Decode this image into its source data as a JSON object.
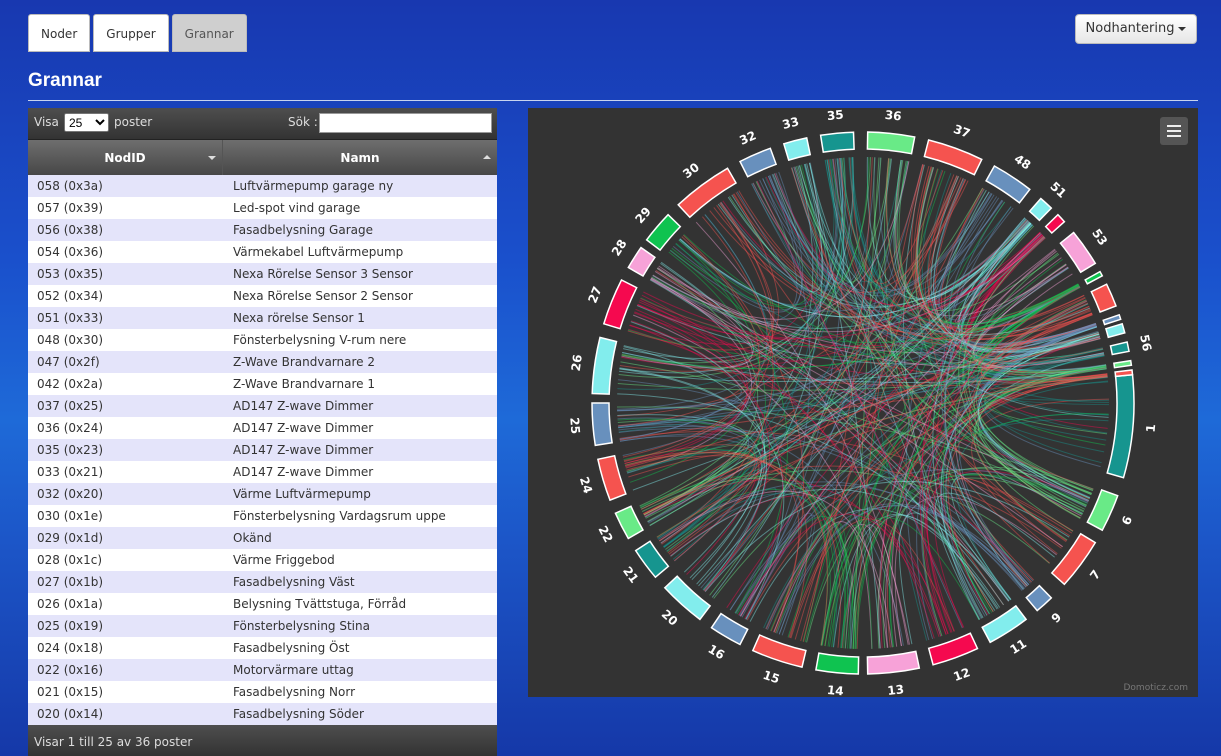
{
  "tabs": [
    {
      "label": "Noder",
      "active": false
    },
    {
      "label": "Grupper",
      "active": false
    },
    {
      "label": "Grannar",
      "active": true
    }
  ],
  "node_management": "Nodhantering",
  "page_title": "Grannar",
  "table": {
    "show_label": "Visa",
    "page_size": "25",
    "page_size_options": [
      "25"
    ],
    "entries_label": "poster",
    "search_label": "Sök :",
    "search_value": "",
    "columns": [
      "NodID",
      "Namn"
    ],
    "rows": [
      [
        "058 (0x3a)",
        "Luftvärmepump garage ny"
      ],
      [
        "057 (0x39)",
        "Led-spot vind garage"
      ],
      [
        "056 (0x38)",
        "Fasadbelysning Garage"
      ],
      [
        "054 (0x36)",
        "Värmekabel Luftvärmepump"
      ],
      [
        "053 (0x35)",
        "Nexa Rörelse Sensor 3 Sensor"
      ],
      [
        "052 (0x34)",
        "Nexa Rörelse Sensor 2 Sensor"
      ],
      [
        "051 (0x33)",
        "Nexa rörelse Sensor 1"
      ],
      [
        "048 (0x30)",
        "Fönsterbelysning V-rum nere"
      ],
      [
        "047 (0x2f)",
        "Z-Wave Brandvarnare 2"
      ],
      [
        "042 (0x2a)",
        "Z-Wave Brandvarnare 1"
      ],
      [
        "037 (0x25)",
        "AD147 Z-wave Dimmer"
      ],
      [
        "036 (0x24)",
        "AD147 Z-wave Dimmer"
      ],
      [
        "035 (0x23)",
        "AD147 Z-wave Dimmer"
      ],
      [
        "033 (0x21)",
        "AD147 Z-wave Dimmer"
      ],
      [
        "032 (0x20)",
        "Värme Luftvärmepump"
      ],
      [
        "030 (0x1e)",
        "Fönsterbelysning Vardagsrum uppe"
      ],
      [
        "029 (0x1d)",
        "Okänd"
      ],
      [
        "028 (0x1c)",
        "Värme Friggebod"
      ],
      [
        "027 (0x1b)",
        "Fasadbelysning Väst"
      ],
      [
        "026 (0x1a)",
        "Belysning Tvättstuga, Förråd"
      ],
      [
        "025 (0x19)",
        "Fönsterbelysning Stina"
      ],
      [
        "024 (0x18)",
        "Fasadbelysning Öst"
      ],
      [
        "022 (0x16)",
        "Motorvärmare uttag"
      ],
      [
        "021 (0x15)",
        "Fasadbelysning Norr"
      ],
      [
        "020 (0x14)",
        "Fasadbelysning Söder"
      ]
    ],
    "footer": "Visar 1 till 25 av 36 poster"
  },
  "chart_data": {
    "type": "chord",
    "credit": "Domoticz.com",
    "nodes": [
      {
        "label": "1",
        "start": 84,
        "end": 106,
        "color": "#16958f"
      },
      {
        "label": "6",
        "start": 110,
        "end": 118,
        "color": "#69ea87"
      },
      {
        "label": "7",
        "start": 121,
        "end": 132,
        "color": "#f5534f"
      },
      {
        "label": "9",
        "start": 136,
        "end": 140,
        "color": "#6890bd"
      },
      {
        "label": "11",
        "start": 143,
        "end": 152,
        "color": "#82eded"
      },
      {
        "label": "12",
        "start": 155,
        "end": 165,
        "color": "#f5094f"
      },
      {
        "label": "13",
        "start": 168,
        "end": 179,
        "color": "#f7a2d8"
      },
      {
        "label": "14",
        "start": 181,
        "end": 190,
        "color": "#0fc350"
      },
      {
        "label": "15",
        "start": 193,
        "end": 204,
        "color": "#f5534f"
      },
      {
        "label": "16",
        "start": 207,
        "end": 214,
        "color": "#6890bd"
      },
      {
        "label": "20",
        "start": 217,
        "end": 227,
        "color": "#82eded"
      },
      {
        "label": "21",
        "start": 230,
        "end": 237,
        "color": "#16958f"
      },
      {
        "label": "22",
        "start": 240,
        "end": 246,
        "color": "#69ea87"
      },
      {
        "label": "24",
        "start": 249,
        "end": 258,
        "color": "#f5534f"
      },
      {
        "label": "25",
        "start": 261,
        "end": 270,
        "color": "#6890bd"
      },
      {
        "label": "26",
        "start": 272,
        "end": 284,
        "color": "#82eded"
      },
      {
        "label": "27",
        "start": 287,
        "end": 297,
        "color": "#f5094f"
      },
      {
        "label": "28",
        "start": 300,
        "end": 305,
        "color": "#f7a2d8"
      },
      {
        "label": "29",
        "start": 307,
        "end": 314,
        "color": "#0fc350"
      },
      {
        "label": "30",
        "start": 317,
        "end": 330,
        "color": "#f5534f"
      },
      {
        "label": "32",
        "start": 333,
        "end": 340,
        "color": "#6890bd"
      },
      {
        "label": "33",
        "start": 343,
        "end": 348,
        "color": "#82eded"
      },
      {
        "label": "35",
        "start": 351,
        "end": 358,
        "color": "#16958f"
      },
      {
        "label": "36",
        "start": 361,
        "end": 371,
        "color": "#69ea87"
      },
      {
        "label": "37",
        "start": 374,
        "end": 386,
        "color": "#f5534f"
      },
      {
        "label": "48",
        "start": 389,
        "end": 398,
        "color": "#6890bd"
      },
      {
        "label": "51",
        "start": 401,
        "end": 404,
        "color": "#82eded"
      },
      {
        "label": "",
        "start": 406,
        "end": 408,
        "color": "#f5094f"
      },
      {
        "label": "53",
        "start": 411,
        "end": 419,
        "color": "#f7a2d8"
      },
      {
        "label": "",
        "start": 421,
        "end": 422,
        "color": "#0fc350"
      },
      {
        "label": "",
        "start": 424,
        "end": 429,
        "color": "#f5534f"
      },
      {
        "label": "",
        "start": 431,
        "end": 432,
        "color": "#6890bd"
      },
      {
        "label": "",
        "start": 433,
        "end": 435,
        "color": "#82eded"
      },
      {
        "label": "56",
        "start": 437,
        "end": 439,
        "color": "#16958f"
      },
      {
        "label": "",
        "start": 441,
        "end": 442,
        "color": "#69ea87"
      },
      {
        "label": "",
        "start": 443,
        "end": 444,
        "color": "#f5534f"
      }
    ]
  }
}
